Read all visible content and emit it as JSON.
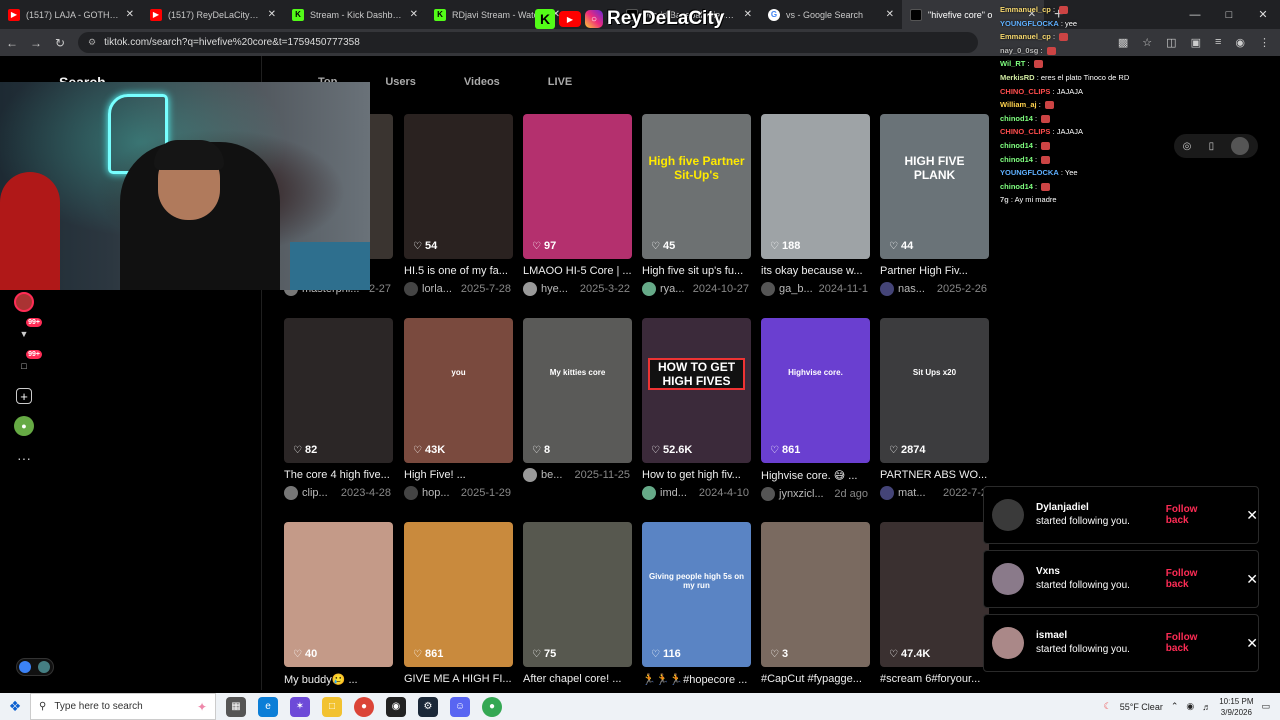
{
  "browser": {
    "tabs": [
      {
        "title": "(1517) LAJA - GOTHAM 2",
        "icon": "youtube-icon",
        "fav": "yt",
        "active": false
      },
      {
        "title": "(1517) ReyDeLaCityShorts",
        "icon": "youtube-icon",
        "fav": "yt",
        "active": false
      },
      {
        "title": "Stream - Kick Dashboard",
        "icon": "kick-icon",
        "fav": "kick",
        "active": false
      },
      {
        "title": "RDjavi Stream - Watch",
        "icon": "kick-icon",
        "fav": "kick",
        "active": false
      },
      {
        "title": "",
        "icon": "none",
        "fav": "",
        "active": false
      },
      {
        "title": "World Baseball Classic | M",
        "icon": "page-icon",
        "fav": "tt",
        "active": false
      },
      {
        "title": "vs - Google Search",
        "icon": "google-icon",
        "fav": "g",
        "active": false
      },
      {
        "title": "\"hivefive core\" o",
        "icon": "tiktok-icon",
        "fav": "tt",
        "active": true
      }
    ],
    "url": "tiktok.com/search?q=hivefive%20core&t=1759450777358"
  },
  "overlay": {
    "name": "ReyDeLaCity"
  },
  "chat": [
    {
      "user": "Emmanuel_cp",
      "msg": "",
      "color": "#f5d76e"
    },
    {
      "user": "YOUNGFLOCKA",
      "msg": "yee",
      "color": "#5fb0ff"
    },
    {
      "user": "Emmanuel_cp",
      "msg": "",
      "color": "#f5d76e"
    },
    {
      "user": "nay_0_0sg",
      "msg": "",
      "color": "#bbbbbb"
    },
    {
      "user": "Wil_RT",
      "msg": "",
      "color": "#7fff7f"
    },
    {
      "user": "MerkisRD",
      "msg": "eres el plato Tinoco de RD",
      "color": "#cfe8a0"
    },
    {
      "user": "CHINO_CLIPS",
      "msg": "JAJAJA",
      "color": "#ff4d4d"
    },
    {
      "user": "William_aj",
      "msg": "",
      "color": "#ffd24d"
    },
    {
      "user": "chinod14",
      "msg": "",
      "color": "#7fff7f"
    },
    {
      "user": "CHINO_CLIPS",
      "msg": "JAJAJA",
      "color": "#ff4d4d"
    },
    {
      "user": "chinod14",
      "msg": "",
      "color": "#7fff7f"
    },
    {
      "user": "chinod14",
      "msg": "",
      "color": "#7fff7f"
    },
    {
      "user": "YOUNGFLOCKA",
      "msg": "Yee",
      "color": "#5fb0ff"
    },
    {
      "user": "chinod14",
      "msg": "",
      "color": "#7fff7f"
    },
    {
      "user": "7g",
      "msg": "Ay mi madre",
      "color": "#cccccc"
    }
  ],
  "tiktok": {
    "search_label": "Search",
    "tabs": [
      "Top",
      "Users",
      "Videos",
      "LIVE"
    ],
    "videos": [
      {
        "likes": "",
        "caption": "...nc...",
        "author": "masterphi...",
        "date": "2-27",
        "bg": "#3a3430"
      },
      {
        "likes": "54",
        "caption": "HI.5 is one of my fa...",
        "author": "lorla...",
        "date": "2025-7-28",
        "bg": "#2a2220"
      },
      {
        "likes": "97",
        "caption": "LMAOO HI-5 Core | ...",
        "author": "hye...",
        "date": "2025-3-22",
        "bg": "#b4306e"
      },
      {
        "likes": "45",
        "caption": "High five sit up's fu...",
        "author": "rya...",
        "date": "2024-10-27",
        "bg": "#6d7172",
        "overlay": "High five Partner Sit-Up's"
      },
      {
        "likes": "188",
        "caption": "its okay because w...",
        "author": "ga_b...",
        "date": "2024-11-1",
        "bg": "#9ea3a6"
      },
      {
        "likes": "44",
        "caption": "Partner High Fiv...",
        "author": "nas...",
        "date": "2025-2-26",
        "bg": "#6a7378",
        "overlay": "HIGH FIVE PLANK"
      },
      {
        "likes": "82",
        "caption": "The core 4 high five...",
        "author": "clip...",
        "date": "2023-4-28",
        "bg": "#2b2626"
      },
      {
        "likes": "43K",
        "caption": "High Five! ...",
        "author": "hop...",
        "date": "2025-1-29",
        "bg": "#7a4a3e",
        "overlay": "you"
      },
      {
        "likes": "8",
        "caption": "",
        "author": "be...",
        "date": "2025-11-25",
        "bg": "#5a5a58",
        "overlay": "My kitties core"
      },
      {
        "likes": "52.6K",
        "caption": "How to get high fiv...",
        "author": "imd...",
        "date": "2024-4-10",
        "bg": "#3b2a3a",
        "overlay": "HOW TO GET HIGH FIVES"
      },
      {
        "likes": "861",
        "caption": "Highvise core. 😅 ...",
        "author": "jynxzicl...",
        "date": "2d ago",
        "bg": "#6a3fd0",
        "overlay": "Highvise core."
      },
      {
        "likes": "2874",
        "caption": "PARTNER ABS WO...",
        "author": "mat...",
        "date": "2022-7-2",
        "bg": "#3c3c3e",
        "overlay": "Sit Ups x20"
      },
      {
        "likes": "40",
        "caption": "My buddy🥲 ...",
        "author": "",
        "date": "",
        "bg": "#c49a88"
      },
      {
        "likes": "861",
        "caption": "GIVE ME A HIGH FI...",
        "author": "",
        "date": "",
        "bg": "#c98a3d"
      },
      {
        "likes": "75",
        "caption": "After chapel core! ...",
        "author": "",
        "date": "",
        "bg": "#57584f"
      },
      {
        "likes": "116",
        "caption": "🏃🏃🏃#hopecore ...",
        "author": "",
        "date": "",
        "bg": "#5a84c4",
        "overlay": "Giving people high 5s on my run"
      },
      {
        "likes": "3",
        "caption": "#CapCut #fypagge...",
        "author": "",
        "date": "",
        "bg": "#7a6a60"
      },
      {
        "likes": "47.4K",
        "caption": "#scream 6#foryour...",
        "author": "",
        "date": "",
        "bg": "#3a3030"
      }
    ],
    "notifications": [
      {
        "name": "Dylanjadiel",
        "text": "started following you.",
        "action": "Follow back"
      },
      {
        "name": "Vxns",
        "text": "started following you.",
        "action": "Follow back"
      },
      {
        "name": "ismael",
        "text": "started following you.",
        "action": "Follow back"
      }
    ],
    "badge_count": "99+",
    "badge_count2": "99+"
  },
  "taskbar": {
    "search_placeholder": "Type here to search",
    "weather": "55°F  Clear",
    "time": "10:15 PM",
    "date": "3/9/2026"
  }
}
